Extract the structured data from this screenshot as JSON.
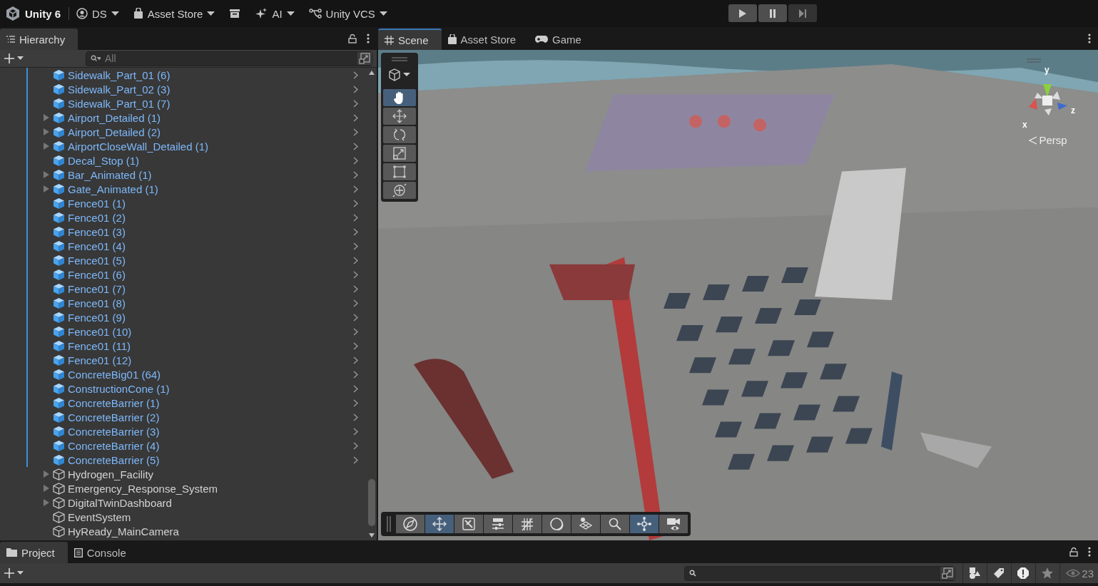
{
  "toolbar": {
    "product": "Unity 6",
    "menus": [
      {
        "kind": "account",
        "label": "DS"
      },
      {
        "kind": "store",
        "label": "Asset Store"
      },
      {
        "kind": "archive"
      },
      {
        "kind": "ai",
        "label": "AI"
      },
      {
        "kind": "vcs",
        "label": "Unity VCS"
      }
    ]
  },
  "play_controls": [
    {
      "kind": "play",
      "disabled": false
    },
    {
      "kind": "pause",
      "disabled": false
    },
    {
      "kind": "step",
      "disabled": true
    }
  ],
  "hierarchy": {
    "title": "Hierarchy",
    "search": {
      "placeholder": "All"
    },
    "rows": [
      {
        "name": "Sidewalk_Part_01 (6)",
        "kind": "prefab",
        "foldout": false
      },
      {
        "name": "Sidewalk_Part_02 (3)",
        "kind": "prefab",
        "foldout": false
      },
      {
        "name": "Sidewalk_Part_01 (7)",
        "kind": "prefab",
        "foldout": false
      },
      {
        "name": "Airport_Detailed (1)",
        "kind": "prefab",
        "foldout": true
      },
      {
        "name": "Airport_Detailed (2)",
        "kind": "prefab",
        "foldout": true
      },
      {
        "name": "AirportCloseWall_Detailed (1)",
        "kind": "prefab",
        "foldout": true
      },
      {
        "name": "Decal_Stop (1)",
        "kind": "prefab",
        "foldout": false
      },
      {
        "name": "Bar_Animated (1)",
        "kind": "prefab",
        "foldout": true
      },
      {
        "name": "Gate_Animated (1)",
        "kind": "prefab",
        "foldout": true
      },
      {
        "name": "Fence01 (1)",
        "kind": "prefab",
        "foldout": false
      },
      {
        "name": "Fence01 (2)",
        "kind": "prefab",
        "foldout": false
      },
      {
        "name": "Fence01 (3)",
        "kind": "prefab",
        "foldout": false
      },
      {
        "name": "Fence01 (4)",
        "kind": "prefab",
        "foldout": false
      },
      {
        "name": "Fence01 (5)",
        "kind": "prefab",
        "foldout": false
      },
      {
        "name": "Fence01 (6)",
        "kind": "prefab",
        "foldout": false
      },
      {
        "name": "Fence01 (7)",
        "kind": "prefab",
        "foldout": false
      },
      {
        "name": "Fence01 (8)",
        "kind": "prefab",
        "foldout": false
      },
      {
        "name": "Fence01 (9)",
        "kind": "prefab",
        "foldout": false
      },
      {
        "name": "Fence01 (10)",
        "kind": "prefab",
        "foldout": false
      },
      {
        "name": "Fence01 (11)",
        "kind": "prefab",
        "foldout": false
      },
      {
        "name": "Fence01 (12)",
        "kind": "prefab",
        "foldout": false
      },
      {
        "name": "ConcreteBig01 (64)",
        "kind": "prefab",
        "foldout": false
      },
      {
        "name": "ConstructionCone (1)",
        "kind": "prefab",
        "foldout": false
      },
      {
        "name": "ConcreteBarrier (1)",
        "kind": "prefab",
        "foldout": false
      },
      {
        "name": "ConcreteBarrier (2)",
        "kind": "prefab",
        "foldout": false
      },
      {
        "name": "ConcreteBarrier (3)",
        "kind": "prefab",
        "foldout": false
      },
      {
        "name": "ConcreteBarrier (4)",
        "kind": "prefab",
        "foldout": false
      },
      {
        "name": "ConcreteBarrier (5)",
        "kind": "prefab",
        "foldout": false
      },
      {
        "name": "Hydrogen_Facility",
        "kind": "object",
        "foldout": true
      },
      {
        "name": "Emergency_Response_System",
        "kind": "object",
        "foldout": true
      },
      {
        "name": "DigitalTwinDashboard",
        "kind": "object",
        "foldout": true
      },
      {
        "name": "EventSystem",
        "kind": "object",
        "foldout": false
      },
      {
        "name": "HyReady_MainCamera",
        "kind": "object",
        "foldout": false
      }
    ]
  },
  "scene_tabs": [
    {
      "kind": "scene",
      "label": "Scene",
      "selected": true
    },
    {
      "kind": "store",
      "label": "Asset Store",
      "selected": false
    },
    {
      "kind": "game",
      "label": "Game",
      "selected": false
    }
  ],
  "scene": {
    "tools": [
      {
        "kind": "hand",
        "selected": true
      },
      {
        "kind": "move",
        "selected": false
      },
      {
        "kind": "rotate",
        "selected": false
      },
      {
        "kind": "scale",
        "selected": false
      },
      {
        "kind": "rect",
        "selected": false
      },
      {
        "kind": "transform",
        "selected": false
      }
    ],
    "overlay_bar": [
      {
        "kind": "compass",
        "selected": false
      },
      {
        "kind": "move",
        "selected": true
      },
      {
        "kind": "snap",
        "selected": false
      },
      {
        "kind": "sliders",
        "selected": false
      },
      {
        "kind": "grid",
        "selected": false
      },
      {
        "kind": "shading",
        "selected": false
      },
      {
        "kind": "layers",
        "selected": false
      },
      {
        "kind": "search",
        "selected": false
      },
      {
        "kind": "pivot",
        "selected": true
      },
      {
        "kind": "camera",
        "selected": false
      }
    ],
    "gizmo": {
      "y": "y",
      "z": "z",
      "x": "x"
    },
    "projection": "Persp"
  },
  "bottom_tabs": [
    {
      "kind": "project",
      "label": "Project",
      "selected": true
    },
    {
      "kind": "console",
      "label": "Console",
      "selected": false
    }
  ],
  "project": {
    "hidden_count": "23"
  }
}
